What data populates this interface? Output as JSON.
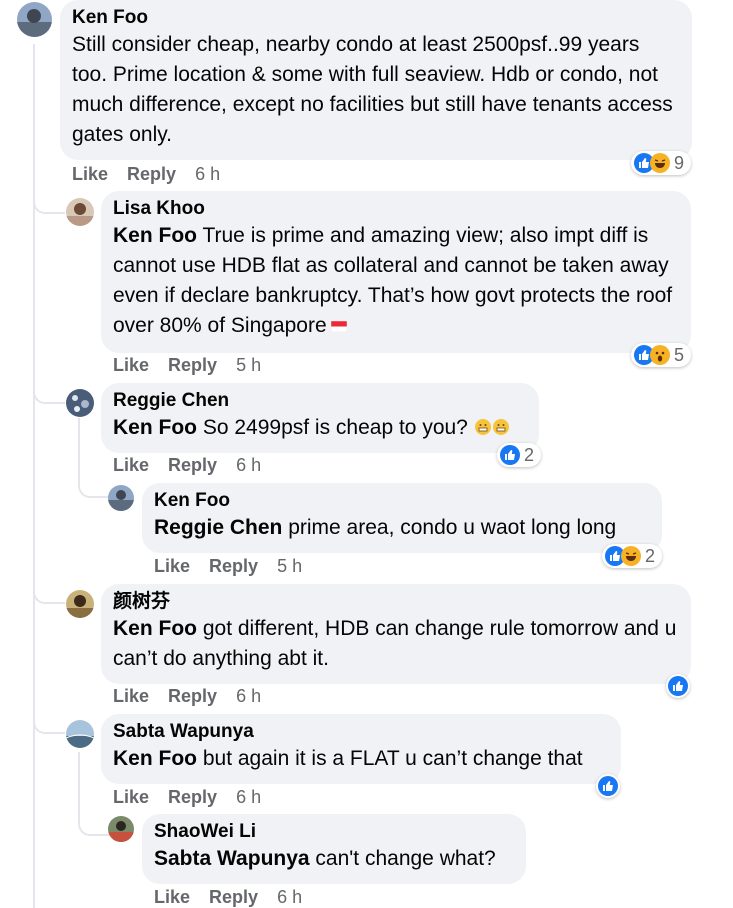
{
  "actions": {
    "like": "Like",
    "reply": "Reply"
  },
  "comments": [
    {
      "author": "Ken Foo",
      "text": "Still consider cheap, nearby condo at least 2500psf..99 years too. Prime location & some with full seaview. Hdb or condo, not much difference, except no facilities but still have tenants access gates only.",
      "time": "6 h",
      "reaction_count": "9",
      "reactions": [
        "like-icon",
        "haha-icon"
      ]
    },
    {
      "author": "Lisa Khoo",
      "mention": "Ken Foo",
      "text": " True is prime and amazing view; also impt diff is cannot use HDB flat as collateral and cannot be taken away even if declare bankruptcy. That’s how govt protects the roof over 80% of Singapore",
      "time": "5 h",
      "reaction_count": "5",
      "reactions": [
        "like-icon",
        "wow-icon"
      ],
      "trailing_emoji": "singapore-flag-icon"
    },
    {
      "author": "Reggie Chen",
      "mention": "Ken Foo",
      "text": " So 2499psf is cheap to you?",
      "time": "6 h",
      "reaction_count": "2",
      "reactions": [
        "like-icon"
      ],
      "trailing_emoji": "grimace-emoji-icons"
    },
    {
      "author": "Ken Foo",
      "mention": "Reggie Chen",
      "text": " prime area, condo u waot long long",
      "time": "5 h",
      "reaction_count": "2",
      "reactions": [
        "like-icon",
        "haha-icon"
      ]
    },
    {
      "author": "颜树芬",
      "mention": "Ken Foo",
      "text": " got different, HDB can change rule tomorrow and u can’t do anything abt it.",
      "time": "6 h",
      "reaction_count": "",
      "reactions": [
        "like-icon"
      ]
    },
    {
      "author": "Sabta Wapunya",
      "mention": "Ken Foo",
      "text": " but again it is a FLAT u can’t change that",
      "time": "6 h",
      "reaction_count": "",
      "reactions": [
        "like-icon"
      ]
    },
    {
      "author": "ShaoWei Li",
      "mention": "Sabta Wapunya",
      "text": " can't change what?",
      "time": "6 h"
    }
  ],
  "colors": {
    "like": "#1877f2",
    "haha": "#f7b125",
    "bubble": "#f0f2f5",
    "meta": "#65676b"
  }
}
